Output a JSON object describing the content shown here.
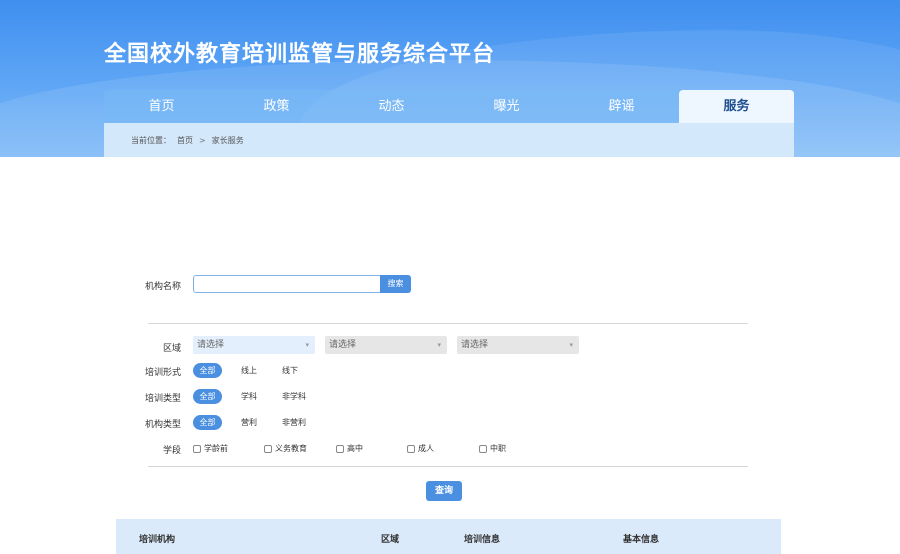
{
  "site": {
    "title": "全国校外教育培训监管与服务综合平台"
  },
  "nav": {
    "items": [
      {
        "label": "首页"
      },
      {
        "label": "政策"
      },
      {
        "label": "动态"
      },
      {
        "label": "曝光"
      },
      {
        "label": "辟谣"
      },
      {
        "label": "服务"
      }
    ],
    "active_index": 5
  },
  "breadcrumb": {
    "prefix": "当前位置：",
    "home": "首页",
    "separator": ">",
    "current": "家长服务"
  },
  "search": {
    "label": "机构名称",
    "value": "",
    "placeholder": "",
    "button_label": "搜索"
  },
  "filters": {
    "region": {
      "label": "区域",
      "selects": [
        "请选择",
        "请选择",
        "请选择"
      ]
    },
    "training_form": {
      "label": "培训形式",
      "options": [
        "全部",
        "线上",
        "线下"
      ],
      "selected": "全部"
    },
    "training_type": {
      "label": "培训类型",
      "options": [
        "全部",
        "学科",
        "非学科"
      ],
      "selected": "全部"
    },
    "org_type": {
      "label": "机构类型",
      "options": [
        "全部",
        "营利",
        "非营利"
      ],
      "selected": "全部"
    },
    "stage": {
      "label": "学段",
      "options": [
        "学龄前",
        "义务教育",
        "高中",
        "成人",
        "中职"
      ]
    }
  },
  "query_button": {
    "label": "查询"
  },
  "table": {
    "headers": [
      "培训机构",
      "区域",
      "培训信息",
      "基本信息"
    ]
  },
  "colors": {
    "accent": "#4a8fe0",
    "banner": "#3f8ff0",
    "table_header_bg": "#dbeafb"
  }
}
